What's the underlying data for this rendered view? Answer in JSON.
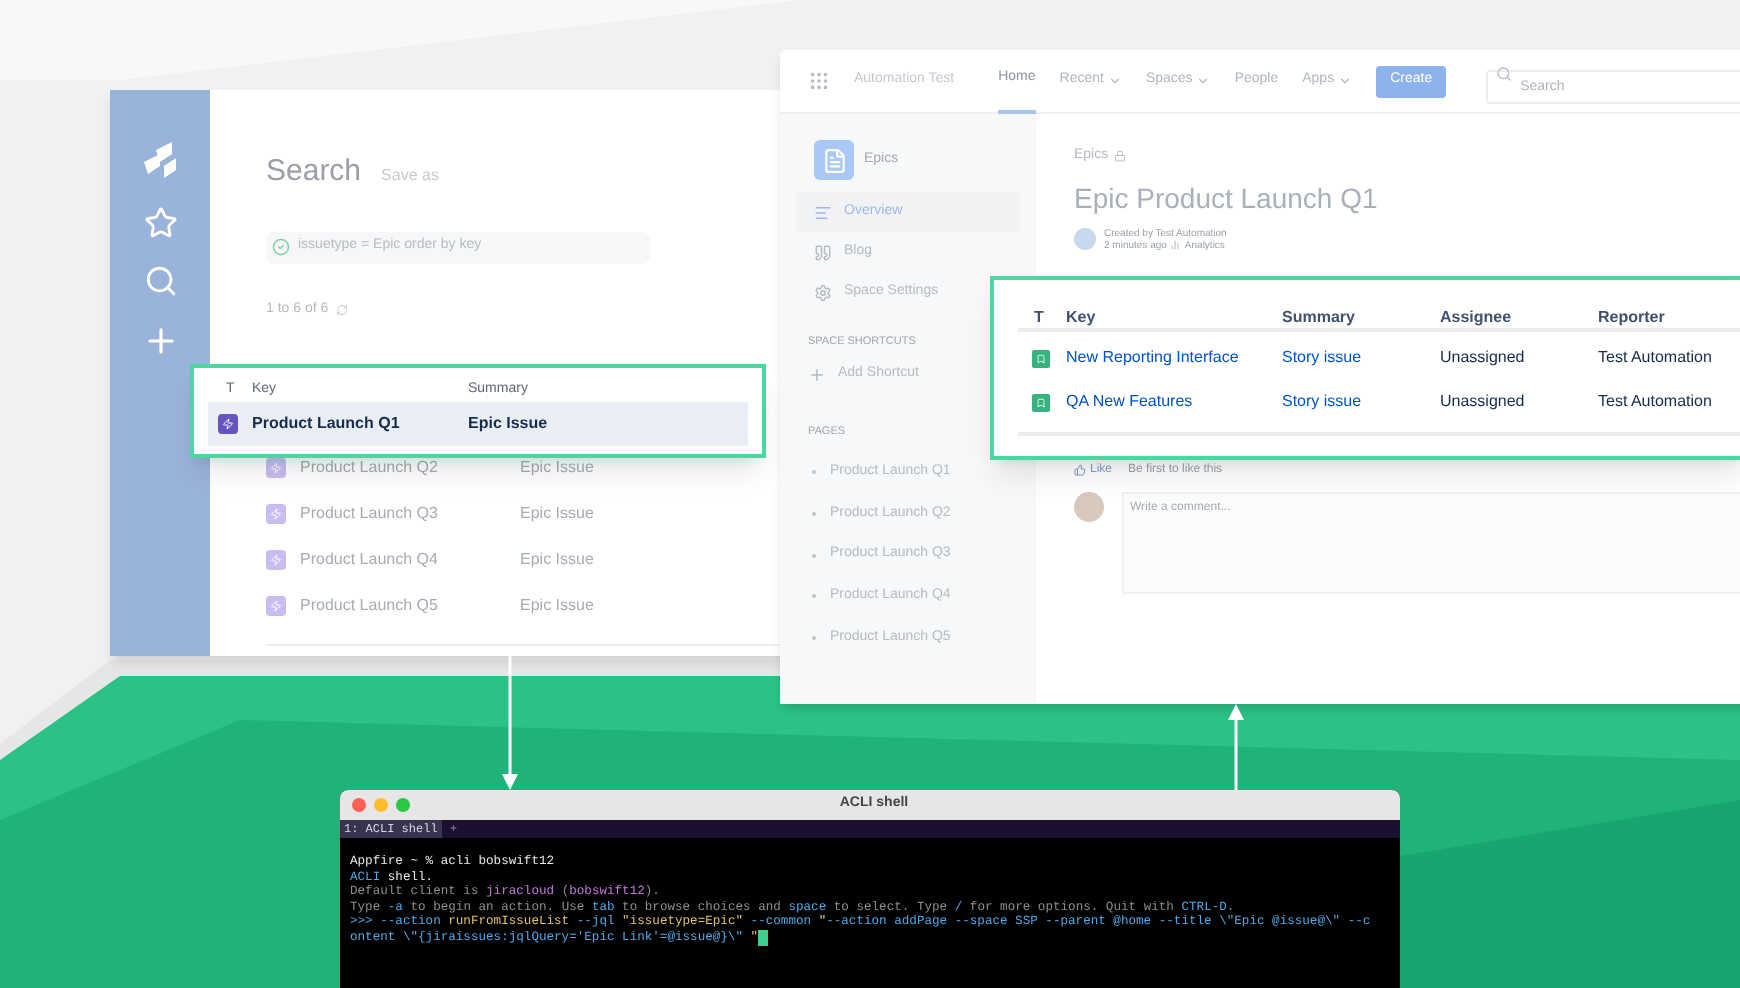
{
  "search_window": {
    "title": "Search",
    "save_as": "Save as",
    "query": "issuetype = Epic order by key",
    "count": "1 to 6 of 6",
    "columns": [
      "T",
      "Key",
      "Summary"
    ],
    "rows": [
      {
        "key": "Product Launch Q1",
        "summary": "Epic Issue",
        "highlighted": true
      },
      {
        "key": "Product Launch Q2",
        "summary": "Epic Issue",
        "highlighted": false
      },
      {
        "key": "Product Launch Q3",
        "summary": "Epic Issue",
        "highlighted": false
      },
      {
        "key": "Product Launch Q4",
        "summary": "Epic Issue",
        "highlighted": false
      },
      {
        "key": "Product Launch Q5",
        "summary": "Epic Issue",
        "highlighted": false
      }
    ]
  },
  "wiki_window": {
    "site": "Automation Test",
    "nav": [
      {
        "label": "Home",
        "selected": true,
        "dropdown": false
      },
      {
        "label": "Recent",
        "selected": false,
        "dropdown": true
      },
      {
        "label": "Spaces",
        "selected": false,
        "dropdown": true
      },
      {
        "label": "People",
        "selected": false,
        "dropdown": false
      },
      {
        "label": "Apps",
        "selected": false,
        "dropdown": true
      }
    ],
    "create": "Create",
    "search_placeholder": "Search",
    "space_name": "Epics",
    "sidebar_items": [
      {
        "label": "Overview",
        "selected": true
      },
      {
        "label": "Blog",
        "selected": false
      },
      {
        "label": "Space Settings",
        "selected": false
      }
    ],
    "shortcuts_heading": "SPACE SHORTCUTS",
    "add_shortcut": "Add Shortcut",
    "pages_heading": "PAGES",
    "pages": [
      "Product Launch Q1",
      "Product Launch Q2",
      "Product Launch Q3",
      "Product Launch Q4",
      "Product Launch Q5"
    ],
    "breadcrumb": "Epics",
    "title": "Epic Product Launch Q1",
    "byline": "Created by Test Automation",
    "time": "2 minutes ago",
    "analytics": "Analytics",
    "like": "Like",
    "like_prompt": "Be first to like this",
    "comment_placeholder": "Write a comment...",
    "issues_table": {
      "columns": [
        "T",
        "Key",
        "Summary",
        "Assignee",
        "Reporter"
      ],
      "rows": [
        {
          "key": "New Reporting Interface",
          "summary": "Story issue",
          "assignee": "Unassigned",
          "reporter": "Test Automation"
        },
        {
          "key": "QA New Features",
          "summary": "Story issue",
          "assignee": "Unassigned",
          "reporter": "Test Automation"
        }
      ]
    }
  },
  "terminal": {
    "title": "ACLI shell",
    "tab": "1: ACLI shell",
    "tab_add": "+",
    "lines": [
      [
        {
          "kind": "plain",
          "text": "Appfire ~ % acli bobswift12"
        }
      ],
      [
        {
          "kind": "blue",
          "text": "ACLI"
        },
        {
          "kind": "plain",
          "text": " shell."
        }
      ],
      [
        {
          "kind": "dim",
          "text": "Default client is "
        },
        {
          "kind": "purple",
          "text": "jiracloud"
        },
        {
          "kind": "dim",
          "text": " ("
        },
        {
          "kind": "purple",
          "text": "bobswift12"
        },
        {
          "kind": "dim",
          "text": ")."
        }
      ],
      [
        {
          "kind": "dim",
          "text": "Type "
        },
        {
          "kind": "blue",
          "text": "-a"
        },
        {
          "kind": "dim",
          "text": " to begin an action. Use "
        },
        {
          "kind": "blue",
          "text": "tab"
        },
        {
          "kind": "dim",
          "text": " to browse choices and "
        },
        {
          "kind": "blue",
          "text": "space"
        },
        {
          "kind": "dim",
          "text": " to select. Type "
        },
        {
          "kind": "blue",
          "text": "/"
        },
        {
          "kind": "dim",
          "text": " for more options. Quit with "
        },
        {
          "kind": "blue",
          "text": "CTRL-D"
        },
        {
          "kind": "dim",
          "text": "."
        }
      ],
      [
        {
          "kind": "blue",
          "text": ">>> --action "
        },
        {
          "kind": "yellow",
          "text": "runFromIssueList"
        },
        {
          "kind": "blue",
          "text": " --jql "
        },
        {
          "kind": "yellow",
          "text": "\"issuetype=Epic\""
        },
        {
          "kind": "blue",
          "text": " --common "
        },
        {
          "kind": "yellow",
          "text": "\""
        },
        {
          "kind": "blue",
          "text": "--action addPage --space SSP --parent @home --title \\\"Epic @issue@\\\" --c"
        }
      ],
      [
        {
          "kind": "blue",
          "text": "ontent \\\"{jiraissues:jqlQuery='Epic Link'=@issue@}\\\" "
        },
        {
          "kind": "yellow",
          "text": "\""
        }
      ]
    ]
  }
}
